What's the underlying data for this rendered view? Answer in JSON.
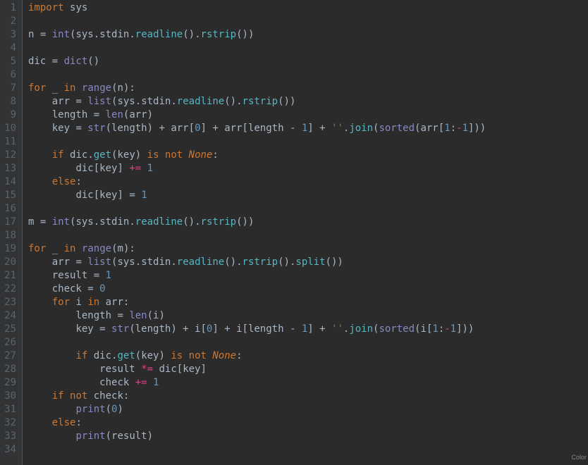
{
  "lineCount": 34,
  "footer": "Color",
  "code": {
    "L1": [
      [
        "kw",
        "import"
      ],
      [
        "sp",
        " "
      ],
      [
        "ident",
        "sys"
      ]
    ],
    "L2": [],
    "L3": [
      [
        "ident",
        "n "
      ],
      [
        "op",
        "= "
      ],
      [
        "builtin",
        "int"
      ],
      [
        "op",
        "("
      ],
      [
        "ident",
        "sys"
      ],
      [
        "op",
        "."
      ],
      [
        "ident",
        "stdin"
      ],
      [
        "op",
        "."
      ],
      [
        "fn",
        "readline"
      ],
      [
        "op",
        "()."
      ],
      [
        "fn",
        "rstrip"
      ],
      [
        "op",
        "())"
      ]
    ],
    "L4": [],
    "L5": [
      [
        "ident",
        "dic "
      ],
      [
        "op",
        "= "
      ],
      [
        "builtin",
        "dict"
      ],
      [
        "op",
        "()"
      ]
    ],
    "L6": [],
    "L7": [
      [
        "kw",
        "for"
      ],
      [
        "sp",
        " "
      ],
      [
        "ident",
        "_"
      ],
      [
        "sp",
        " "
      ],
      [
        "kw",
        "in"
      ],
      [
        "sp",
        " "
      ],
      [
        "builtin",
        "range"
      ],
      [
        "op",
        "("
      ],
      [
        "ident",
        "n"
      ],
      [
        "op",
        "):"
      ]
    ],
    "L8": [
      [
        "sp",
        "    "
      ],
      [
        "ident",
        "arr "
      ],
      [
        "op",
        "= "
      ],
      [
        "builtin",
        "list"
      ],
      [
        "op",
        "("
      ],
      [
        "ident",
        "sys"
      ],
      [
        "op",
        "."
      ],
      [
        "ident",
        "stdin"
      ],
      [
        "op",
        "."
      ],
      [
        "fn",
        "readline"
      ],
      [
        "op",
        "()."
      ],
      [
        "fn",
        "rstrip"
      ],
      [
        "op",
        "())"
      ]
    ],
    "L9": [
      [
        "sp",
        "    "
      ],
      [
        "ident",
        "length "
      ],
      [
        "op",
        "= "
      ],
      [
        "builtin",
        "len"
      ],
      [
        "op",
        "("
      ],
      [
        "ident",
        "arr"
      ],
      [
        "op",
        ")"
      ]
    ],
    "L10": [
      [
        "sp",
        "    "
      ],
      [
        "ident",
        "key "
      ],
      [
        "op",
        "= "
      ],
      [
        "builtin",
        "str"
      ],
      [
        "op",
        "("
      ],
      [
        "ident",
        "length"
      ],
      [
        "op",
        ") + "
      ],
      [
        "ident",
        "arr"
      ],
      [
        "op",
        "["
      ],
      [
        "num",
        "0"
      ],
      [
        "op",
        "] + "
      ],
      [
        "ident",
        "arr"
      ],
      [
        "op",
        "["
      ],
      [
        "ident",
        "length "
      ],
      [
        "op",
        "- "
      ],
      [
        "num",
        "1"
      ],
      [
        "op",
        "] + "
      ],
      [
        "str",
        "''"
      ],
      [
        "op",
        "."
      ],
      [
        "fn",
        "join"
      ],
      [
        "op",
        "("
      ],
      [
        "builtin",
        "sorted"
      ],
      [
        "op",
        "("
      ],
      [
        "ident",
        "arr"
      ],
      [
        "op",
        "["
      ],
      [
        "num",
        "1"
      ],
      [
        "op",
        ":"
      ],
      [
        "magenta",
        "-"
      ],
      [
        "num",
        "1"
      ],
      [
        "op",
        "]))"
      ]
    ],
    "L11": [],
    "L12": [
      [
        "sp",
        "    "
      ],
      [
        "kw",
        "if"
      ],
      [
        "sp",
        " "
      ],
      [
        "ident",
        "dic"
      ],
      [
        "op",
        "."
      ],
      [
        "fn",
        "get"
      ],
      [
        "op",
        "("
      ],
      [
        "ident",
        "key"
      ],
      [
        "op",
        ") "
      ],
      [
        "kw",
        "is not"
      ],
      [
        "sp",
        " "
      ],
      [
        "none",
        "None"
      ],
      [
        "op",
        ":"
      ]
    ],
    "L13": [
      [
        "sp",
        "        "
      ],
      [
        "ident",
        "dic"
      ],
      [
        "op",
        "["
      ],
      [
        "ident",
        "key"
      ],
      [
        "op",
        "] "
      ],
      [
        "magenta",
        "+="
      ],
      [
        "sp",
        " "
      ],
      [
        "num",
        "1"
      ]
    ],
    "L14": [
      [
        "sp",
        "    "
      ],
      [
        "kw",
        "else"
      ],
      [
        "op",
        ":"
      ]
    ],
    "L15": [
      [
        "sp",
        "        "
      ],
      [
        "ident",
        "dic"
      ],
      [
        "op",
        "["
      ],
      [
        "ident",
        "key"
      ],
      [
        "op",
        "] = "
      ],
      [
        "num",
        "1"
      ]
    ],
    "L16": [],
    "L17": [
      [
        "ident",
        "m "
      ],
      [
        "op",
        "= "
      ],
      [
        "builtin",
        "int"
      ],
      [
        "op",
        "("
      ],
      [
        "ident",
        "sys"
      ],
      [
        "op",
        "."
      ],
      [
        "ident",
        "stdin"
      ],
      [
        "op",
        "."
      ],
      [
        "fn",
        "readline"
      ],
      [
        "op",
        "()."
      ],
      [
        "fn",
        "rstrip"
      ],
      [
        "op",
        "())"
      ]
    ],
    "L18": [],
    "L19": [
      [
        "kw",
        "for"
      ],
      [
        "sp",
        " "
      ],
      [
        "ident",
        "_"
      ],
      [
        "sp",
        " "
      ],
      [
        "kw",
        "in"
      ],
      [
        "sp",
        " "
      ],
      [
        "builtin",
        "range"
      ],
      [
        "op",
        "("
      ],
      [
        "ident",
        "m"
      ],
      [
        "op",
        "):"
      ]
    ],
    "L20": [
      [
        "sp",
        "    "
      ],
      [
        "ident",
        "arr "
      ],
      [
        "op",
        "= "
      ],
      [
        "builtin",
        "list"
      ],
      [
        "op",
        "("
      ],
      [
        "ident",
        "sys"
      ],
      [
        "op",
        "."
      ],
      [
        "ident",
        "stdin"
      ],
      [
        "op",
        "."
      ],
      [
        "fn",
        "readline"
      ],
      [
        "op",
        "()."
      ],
      [
        "fn",
        "rstrip"
      ],
      [
        "op",
        "()."
      ],
      [
        "fn",
        "split"
      ],
      [
        "op",
        "())"
      ]
    ],
    "L21": [
      [
        "sp",
        "    "
      ],
      [
        "ident",
        "result "
      ],
      [
        "op",
        "= "
      ],
      [
        "num",
        "1"
      ]
    ],
    "L22": [
      [
        "sp",
        "    "
      ],
      [
        "ident",
        "check "
      ],
      [
        "op",
        "= "
      ],
      [
        "num",
        "0"
      ]
    ],
    "L23": [
      [
        "sp",
        "    "
      ],
      [
        "kw",
        "for"
      ],
      [
        "sp",
        " "
      ],
      [
        "ident",
        "i"
      ],
      [
        "sp",
        " "
      ],
      [
        "kw",
        "in"
      ],
      [
        "sp",
        " "
      ],
      [
        "ident",
        "arr"
      ],
      [
        "op",
        ":"
      ]
    ],
    "L24": [
      [
        "sp",
        "        "
      ],
      [
        "ident",
        "length "
      ],
      [
        "op",
        "= "
      ],
      [
        "builtin",
        "len"
      ],
      [
        "op",
        "("
      ],
      [
        "ident",
        "i"
      ],
      [
        "op",
        ")"
      ]
    ],
    "L25": [
      [
        "sp",
        "        "
      ],
      [
        "ident",
        "key "
      ],
      [
        "op",
        "= "
      ],
      [
        "builtin",
        "str"
      ],
      [
        "op",
        "("
      ],
      [
        "ident",
        "length"
      ],
      [
        "op",
        ") + "
      ],
      [
        "ident",
        "i"
      ],
      [
        "op",
        "["
      ],
      [
        "num",
        "0"
      ],
      [
        "op",
        "] + "
      ],
      [
        "ident",
        "i"
      ],
      [
        "op",
        "["
      ],
      [
        "ident",
        "length "
      ],
      [
        "op",
        "- "
      ],
      [
        "num",
        "1"
      ],
      [
        "op",
        "] + "
      ],
      [
        "str",
        "''"
      ],
      [
        "op",
        "."
      ],
      [
        "fn",
        "join"
      ],
      [
        "op",
        "("
      ],
      [
        "builtin",
        "sorted"
      ],
      [
        "op",
        "("
      ],
      [
        "ident",
        "i"
      ],
      [
        "op",
        "["
      ],
      [
        "num",
        "1"
      ],
      [
        "op",
        ":"
      ],
      [
        "magenta",
        "-"
      ],
      [
        "num",
        "1"
      ],
      [
        "op",
        "]))"
      ]
    ],
    "L26": [],
    "L27": [
      [
        "sp",
        "        "
      ],
      [
        "kw",
        "if"
      ],
      [
        "sp",
        " "
      ],
      [
        "ident",
        "dic"
      ],
      [
        "op",
        "."
      ],
      [
        "fn",
        "get"
      ],
      [
        "op",
        "("
      ],
      [
        "ident",
        "key"
      ],
      [
        "op",
        ") "
      ],
      [
        "kw",
        "is not"
      ],
      [
        "sp",
        " "
      ],
      [
        "none",
        "None"
      ],
      [
        "op",
        ":"
      ]
    ],
    "L28": [
      [
        "sp",
        "            "
      ],
      [
        "ident",
        "result "
      ],
      [
        "magenta",
        "*="
      ],
      [
        "sp",
        " "
      ],
      [
        "ident",
        "dic"
      ],
      [
        "op",
        "["
      ],
      [
        "ident",
        "key"
      ],
      [
        "op",
        "]"
      ]
    ],
    "L29": [
      [
        "sp",
        "            "
      ],
      [
        "ident",
        "check "
      ],
      [
        "magenta",
        "+="
      ],
      [
        "sp",
        " "
      ],
      [
        "num",
        "1"
      ]
    ],
    "L30": [
      [
        "sp",
        "    "
      ],
      [
        "kw",
        "if"
      ],
      [
        "sp",
        " "
      ],
      [
        "kw",
        "not"
      ],
      [
        "sp",
        " "
      ],
      [
        "ident",
        "check"
      ],
      [
        "op",
        ":"
      ]
    ],
    "L31": [
      [
        "sp",
        "        "
      ],
      [
        "builtin",
        "print"
      ],
      [
        "op",
        "("
      ],
      [
        "num",
        "0"
      ],
      [
        "op",
        ")"
      ]
    ],
    "L32": [
      [
        "sp",
        "    "
      ],
      [
        "kw",
        "else"
      ],
      [
        "op",
        ":"
      ]
    ],
    "L33": [
      [
        "sp",
        "        "
      ],
      [
        "builtin",
        "print"
      ],
      [
        "op",
        "("
      ],
      [
        "ident",
        "result"
      ],
      [
        "op",
        ")"
      ]
    ],
    "L34": []
  }
}
